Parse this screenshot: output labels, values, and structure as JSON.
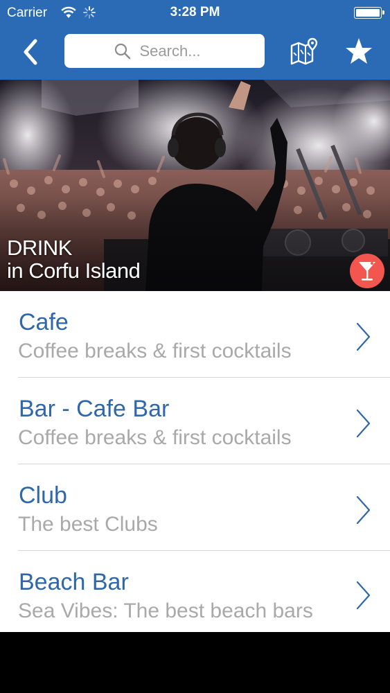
{
  "status_bar": {
    "carrier": "Carrier",
    "time": "3:28 PM",
    "wifi_icon": "wifi-icon",
    "activity_icon": "activity-spinner-icon",
    "battery_icon": "battery-icon"
  },
  "nav": {
    "back_icon": "chevron-left-icon",
    "search_placeholder": "Search...",
    "search_value": "",
    "map_icon": "map-pin-icon",
    "favorites_icon": "star-icon",
    "bar_color": "#2b6bb6"
  },
  "hero": {
    "title": "DRINK",
    "subtitle": "in Corfu Island",
    "badge_icon": "cocktail-icon",
    "badge_color": "#f2564e"
  },
  "categories": [
    {
      "title": "Cafe",
      "subtitle": "Coffee breaks & first cocktails"
    },
    {
      "title": "Bar - Cafe Bar",
      "subtitle": "Coffee breaks & first cocktails"
    },
    {
      "title": "Club",
      "subtitle": "The best Clubs"
    },
    {
      "title": "Beach Bar",
      "subtitle": "Sea Vibes: The best beach bars"
    }
  ],
  "colors": {
    "title_text": "#2e67ac",
    "subtitle_text": "#a9a9a9"
  }
}
